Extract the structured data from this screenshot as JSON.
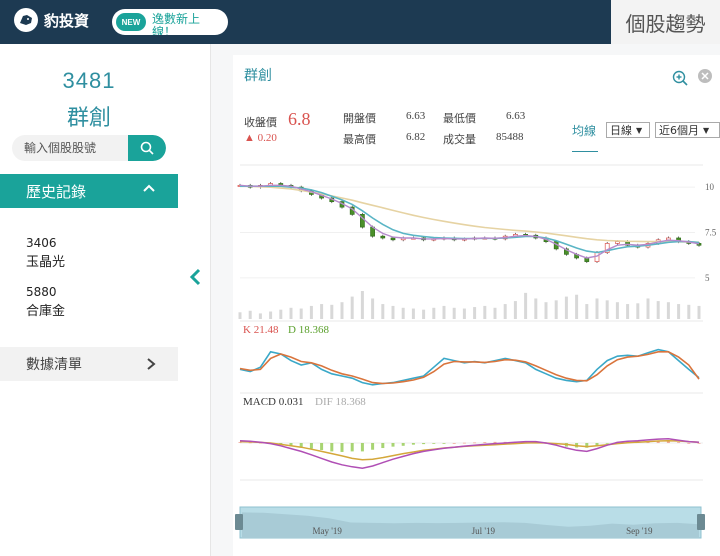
{
  "header": {
    "logo_text": "豹投資",
    "pill_badge": "NEW",
    "pill_text": "逸數新上線！",
    "page_tag": "個股趨勢"
  },
  "sidebar": {
    "stock_code": "3481",
    "stock_name": "群創",
    "search_placeholder": "輸入個股股號",
    "history_title": "歷史記錄",
    "history": [
      {
        "code": "3406",
        "name": "玉晶光"
      },
      {
        "code": "5880",
        "name": "合庫金"
      }
    ],
    "list_title": "數據清單"
  },
  "card": {
    "title": "群創",
    "quote": {
      "close_label": "收盤價",
      "close_value": "6.8",
      "change": "▲ 0.20",
      "open_label": "開盤價",
      "open_value": "6.63",
      "low_label": "最低價",
      "low_value": "6.63",
      "high_label": "最高價",
      "high_value": "6.82",
      "volume_label": "成交量",
      "volume_value": "85488"
    },
    "avg_label": "均線",
    "period_select": "日線",
    "range_select": "近6個月",
    "kd_k": "K 21.48",
    "kd_d": "D 18.368",
    "macd_label": "MACD 0.031",
    "dif_label": "DIF 18.368",
    "colors": {
      "accent": "#1aa39a",
      "header": "#1d3a52",
      "up": "#d9534f",
      "kd_k": "#d9534f",
      "kd_d": "#5aa02c"
    }
  },
  "chart_data": {
    "type": "line",
    "y_ticks": [
      "10",
      "7.5",
      "5"
    ],
    "x_ticks": [
      "May '19",
      "Jul '19",
      "Sep '19"
    ],
    "price_range": [
      4.5,
      11
    ],
    "price": [
      10.1,
      10.0,
      10.1,
      10.2,
      10.1,
      10.0,
      9.8,
      9.6,
      9.4,
      9.2,
      8.9,
      8.5,
      7.8,
      7.3,
      7.2,
      7.1,
      7.2,
      7.2,
      7.1,
      7.15,
      7.2,
      7.1,
      7.15,
      7.2,
      7.2,
      7.15,
      7.3,
      7.4,
      7.35,
      7.2,
      7.0,
      6.6,
      6.3,
      6.1,
      5.9,
      6.4,
      6.9,
      7.0,
      6.8,
      6.7,
      6.9,
      7.1,
      7.2,
      7.0,
      6.9,
      6.8
    ],
    "ma_short": [
      10.1,
      10.05,
      10.05,
      10.1,
      10.1,
      10.05,
      9.9,
      9.75,
      9.55,
      9.35,
      9.1,
      8.8,
      8.3,
      7.8,
      7.45,
      7.25,
      7.2,
      7.2,
      7.15,
      7.15,
      7.17,
      7.15,
      7.15,
      7.17,
      7.2,
      7.18,
      7.22,
      7.3,
      7.33,
      7.28,
      7.13,
      6.85,
      6.55,
      6.3,
      6.1,
      6.2,
      6.55,
      6.8,
      6.85,
      6.8,
      6.85,
      6.98,
      7.08,
      7.05,
      6.98,
      6.88
    ],
    "ma_mid": [
      10.05,
      10.05,
      10.05,
      10.05,
      10.05,
      10.0,
      9.95,
      9.85,
      9.7,
      9.5,
      9.3,
      9.05,
      8.7,
      8.3,
      7.95,
      7.65,
      7.45,
      7.35,
      7.28,
      7.22,
      7.2,
      7.18,
      7.17,
      7.17,
      7.18,
      7.18,
      7.2,
      7.24,
      7.28,
      7.28,
      7.2,
      7.05,
      6.85,
      6.65,
      6.48,
      6.4,
      6.5,
      6.62,
      6.72,
      6.75,
      6.8,
      6.88,
      6.96,
      7.0,
      7.0,
      6.95
    ],
    "ma_long": [
      10.05,
      10.05,
      10.02,
      10.0,
      9.95,
      9.9,
      9.82,
      9.73,
      9.63,
      9.52,
      9.4,
      9.28,
      9.14,
      9.0,
      8.86,
      8.72,
      8.58,
      8.45,
      8.33,
      8.22,
      8.12,
      8.02,
      7.93,
      7.85,
      7.78,
      7.72,
      7.67,
      7.62,
      7.58,
      7.53,
      7.47,
      7.4,
      7.32,
      7.24,
      7.16,
      7.1,
      7.06,
      7.04,
      7.02,
      7.01,
      7.0,
      7.0,
      7.0,
      6.99,
      6.98,
      6.97
    ],
    "volume": [
      18,
      22,
      15,
      20,
      25,
      30,
      28,
      35,
      40,
      38,
      45,
      60,
      75,
      55,
      40,
      35,
      30,
      28,
      25,
      30,
      35,
      30,
      28,
      32,
      35,
      30,
      40,
      48,
      70,
      55,
      45,
      50,
      60,
      65,
      40,
      55,
      50,
      45,
      40,
      42,
      55,
      48,
      45,
      40,
      38,
      35
    ],
    "kd_k_series": [
      40,
      35,
      45,
      80,
      75,
      60,
      50,
      55,
      40,
      30,
      25,
      20,
      10,
      5,
      8,
      10,
      15,
      20,
      25,
      45,
      65,
      60,
      55,
      58,
      55,
      60,
      65,
      60,
      55,
      40,
      30,
      20,
      15,
      12,
      15,
      40,
      60,
      70,
      72,
      70,
      78,
      85,
      80,
      60,
      40,
      21
    ],
    "kd_d_series": [
      42,
      38,
      40,
      65,
      75,
      68,
      58,
      55,
      48,
      38,
      30,
      25,
      18,
      10,
      8,
      9,
      12,
      16,
      22,
      35,
      52,
      58,
      57,
      57,
      56,
      58,
      62,
      61,
      57,
      48,
      38,
      28,
      20,
      15,
      14,
      28,
      48,
      62,
      68,
      70,
      74,
      80,
      80,
      68,
      50,
      18
    ],
    "macd_series": [
      0.05,
      0.04,
      0.02,
      0.0,
      -0.05,
      -0.1,
      -0.15,
      -0.22,
      -0.3,
      -0.38,
      -0.46,
      -0.55,
      -0.6,
      -0.58,
      -0.52,
      -0.45,
      -0.38,
      -0.32,
      -0.26,
      -0.22,
      -0.18,
      -0.15,
      -0.12,
      -0.1,
      -0.08,
      -0.06,
      -0.04,
      -0.02,
      0.0,
      0.01,
      0.0,
      -0.02,
      -0.05,
      -0.1,
      -0.13,
      -0.1,
      -0.06,
      -0.02,
      0.01,
      0.03,
      0.05,
      0.07,
      0.08,
      0.07,
      0.05,
      0.03
    ],
    "dif_series": [
      0.08,
      0.06,
      0.03,
      -0.02,
      -0.1,
      -0.2,
      -0.3,
      -0.42,
      -0.55,
      -0.68,
      -0.78,
      -0.85,
      -0.9,
      -0.82,
      -0.7,
      -0.58,
      -0.48,
      -0.38,
      -0.3,
      -0.24,
      -0.19,
      -0.15,
      -0.11,
      -0.08,
      -0.05,
      -0.02,
      0.0,
      0.03,
      0.05,
      0.05,
      0.0,
      -0.08,
      -0.18,
      -0.26,
      -0.3,
      -0.2,
      -0.08,
      0.02,
      0.06,
      0.08,
      0.11,
      0.14,
      0.15,
      0.1,
      0.05,
      0.03
    ],
    "nav_series": [
      10.1,
      10.0,
      9.6,
      9.2,
      8.5,
      7.3,
      7.2,
      7.1,
      7.2,
      7.15,
      7.2,
      7.3,
      7.4,
      7.2,
      6.6,
      6.1,
      6.4,
      7.0,
      6.7,
      7.1,
      7.2,
      6.8
    ]
  }
}
